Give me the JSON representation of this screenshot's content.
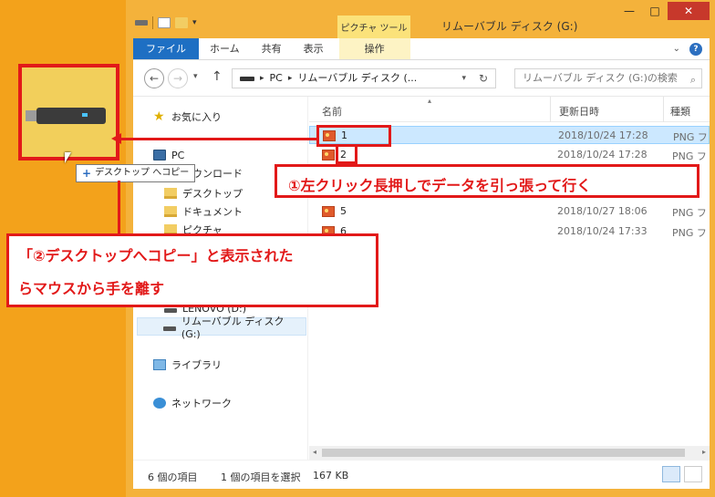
{
  "window": {
    "context_tab_header": "ピクチャ ツール",
    "title": "リムーバブル ディスク (G:)",
    "controls": {
      "minimize": "—",
      "maximize": "□",
      "close": "✕"
    }
  },
  "ribbon": {
    "tabs": {
      "file": "ファイル",
      "home": "ホーム",
      "share": "共有",
      "view": "表示",
      "manage": "操作"
    },
    "help": "?",
    "expand": "⌄"
  },
  "navbar": {
    "back": "←",
    "forward": "→",
    "dropdown": "▾",
    "up": "↑",
    "breadcrumb": [
      "PC",
      "リムーバブル ディスク (..."
    ],
    "crumb_sep": "▸",
    "addr_dropdown": "▾",
    "refresh": "↻",
    "search_placeholder": "リムーバブル ディスク (G:)の検索",
    "search_icon": "⌕"
  },
  "navpane": {
    "favorites": "お気に入り",
    "pc": "PC",
    "downloads": "ダウンロード",
    "desktop": "デスクトップ",
    "documents": "ドキュメント",
    "pictures": "ピクチャ",
    "drive_d": "LENOVO (D:)",
    "drive_g": "リムーバブル ディスク (G:)",
    "libraries": "ライブラリ",
    "network": "ネットワーク"
  },
  "filepane": {
    "columns": {
      "name": "名前",
      "date": "更新日時",
      "type": "種類",
      "sort": "▴"
    },
    "files": [
      {
        "name": "1",
        "date": "2018/10/24 17:28",
        "type": "PNG フ"
      },
      {
        "name": "2",
        "date": "2018/10/24 17:28",
        "type": "PNG フ"
      },
      {
        "name": "5",
        "date": "2018/10/27 18:06",
        "type": "PNG フ"
      },
      {
        "name": "6",
        "date": "2018/10/24 17:33",
        "type": "PNG フ"
      }
    ],
    "scroll_left": "◂",
    "scroll_right": "▸"
  },
  "status": {
    "item_count": "6 個の項目",
    "selected": "1 個の項目を選択",
    "size": "167 KB"
  },
  "drag": {
    "tooltip": "デスクトップ へコピー",
    "plus": "+"
  },
  "annotations": {
    "step1": "①左クリック長押しでデータを引っ張って行く",
    "step2_line1": "「②デスクトップへコピー」と表示された",
    "step2_line2": "らマウスから手を離す"
  },
  "colors": {
    "desktop": "#f3a21b",
    "annotation_red": "#e21919",
    "file_tab": "#1e6fc3",
    "selection": "#cce8ff"
  },
  "icons": [
    "star-icon",
    "pc-icon",
    "folder-icon",
    "drive-icon",
    "library-icon",
    "network-icon",
    "png-file-icon",
    "help-icon",
    "refresh-icon",
    "search-icon"
  ]
}
